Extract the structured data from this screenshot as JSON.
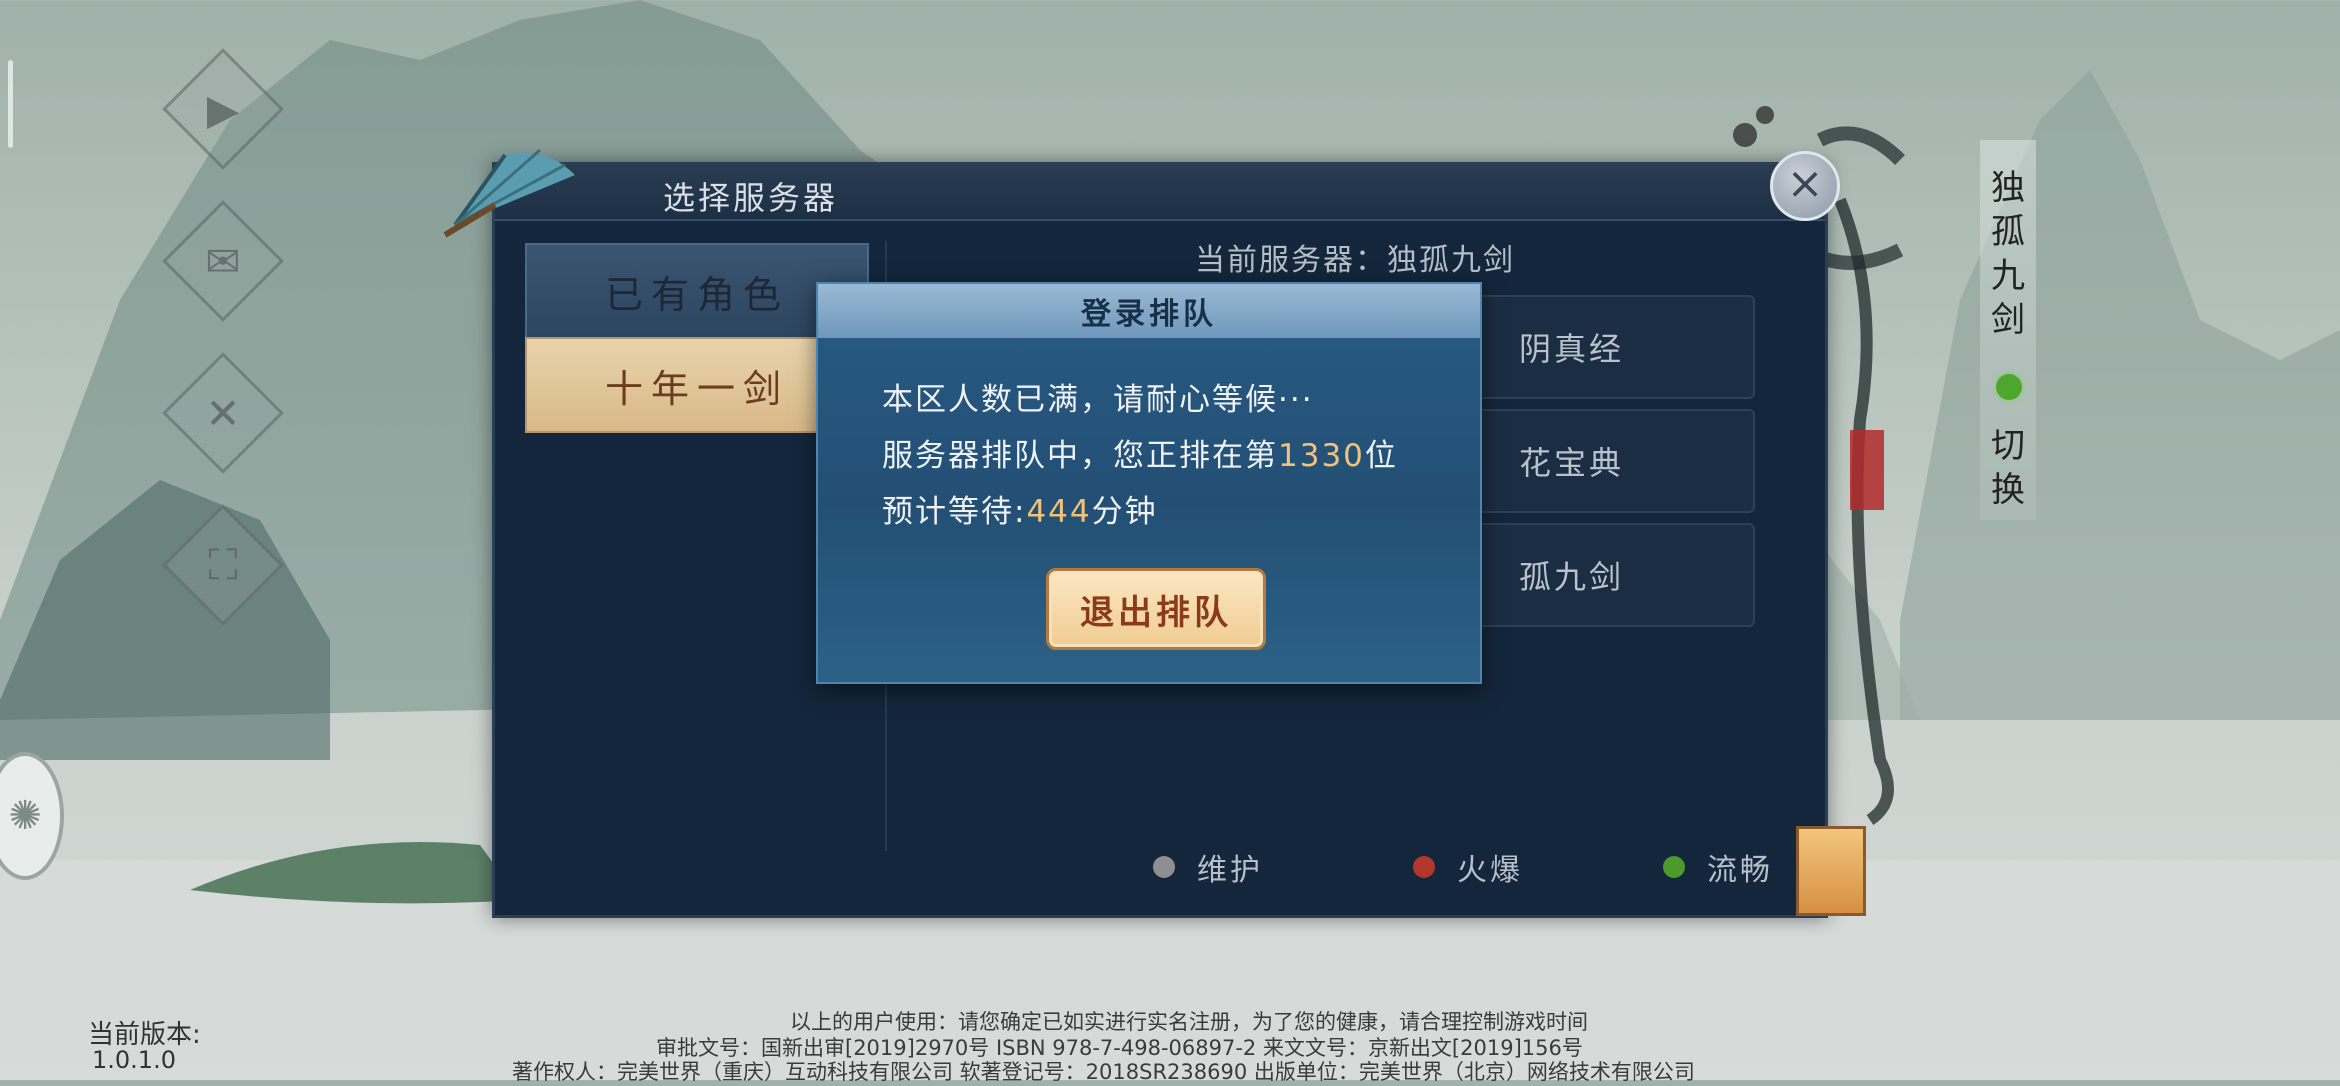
{
  "dialog": {
    "title": "选择服务器",
    "current_server": "当前服务器：独孤九剑",
    "tabs": [
      "已有角色",
      "十年一剑"
    ],
    "servers": [
      "阴真经",
      "花宝典",
      "孤九剑"
    ],
    "legend": [
      {
        "label": "维护",
        "color": "#8f8f8f"
      },
      {
        "label": "火爆",
        "color": "#b3362a"
      },
      {
        "label": "流畅",
        "color": "#4a9a2c"
      }
    ]
  },
  "queue": {
    "title": "登录排队",
    "line1": "本区人数已满，请耐心等候···",
    "line2_prefix": "服务器排队中，您正排在第",
    "position": "1330",
    "line2_suffix": "位",
    "line3_prefix": "预计等待:",
    "wait": "444",
    "line3_suffix": "分钟",
    "exit_button": "退出排队"
  },
  "side_panel": {
    "server_chars": [
      "独",
      "孤",
      "九",
      "剑"
    ],
    "switch_chars": [
      "切",
      "换"
    ],
    "status_color": "#4da62e"
  },
  "footer": {
    "version_label": "当前版本:",
    "version": "1.0.1.0",
    "line1": "以上的用户使用：请您确定已如实进行实名注册，为了您的健康，请合理控制游戏时间",
    "line2": "审批文号：国新出审[2019]2970号  ISBN  978-7-498-06897-2  来文文号：京新出文[2019]156号",
    "line3": "著作权人：完美世界（重庆）互动科技有限公司  软著登记号：2018SR238690  出版单位：完美世界（北京）网络技术有限公司"
  }
}
